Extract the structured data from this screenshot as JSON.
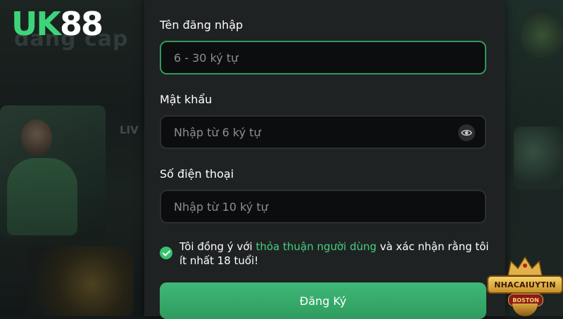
{
  "brand": {
    "logo_uk": "UK",
    "logo_num": "88"
  },
  "background": {
    "ghost_text": "dang cap",
    "live_text": "LIV"
  },
  "form": {
    "username": {
      "label": "Tên đăng nhập",
      "placeholder": "6 - 30 ký tự",
      "focused": true
    },
    "password": {
      "label": "Mật khẩu",
      "placeholder": "Nhập từ 6 ký tự",
      "toggle_icon": "eye-icon"
    },
    "phone": {
      "label": "Số điện thoại",
      "placeholder": "Nhập từ 10 ký tự"
    },
    "agreement": {
      "checked": true,
      "text_before": "Tôi đồng ý với ",
      "link_text": "thỏa thuận người dùng",
      "text_after": " và xác nhận rằng tôi ít nhất 18 tuổi!"
    },
    "submit_label": "Đăng Ký"
  },
  "watermark": {
    "main": "NHACAIUYTIN",
    "sub": "BOSTON"
  },
  "colors": {
    "accent": "#3ed47a",
    "button": "#34a868",
    "panel": "#1f2223",
    "input_bg": "#0c0d0e",
    "focus_border": "#2f9a5b"
  }
}
